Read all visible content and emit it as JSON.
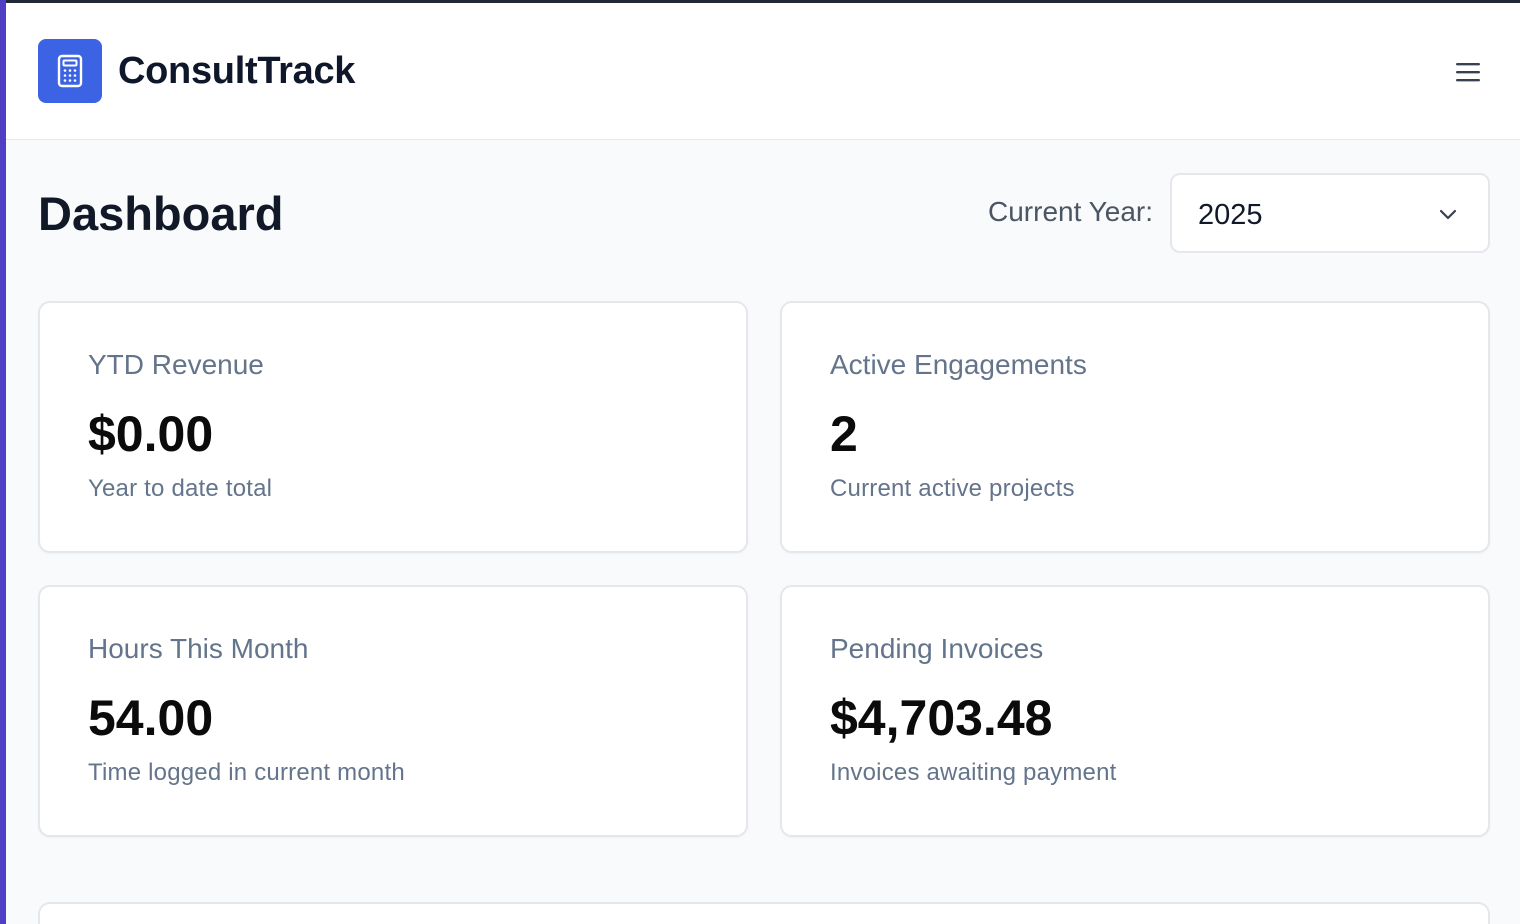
{
  "app": {
    "name": "ConsultTrack",
    "logo_icon": "calculator-icon",
    "accent": "#3b63e3"
  },
  "header": {
    "menu_icon": "hamburger-menu-icon"
  },
  "dashboard": {
    "title": "Dashboard",
    "year_filter": {
      "label": "Current Year:",
      "selected": "2025"
    }
  },
  "cards": [
    {
      "label": "YTD Revenue",
      "value": "$0.00",
      "sub": "Year to date total"
    },
    {
      "label": "Active Engagements",
      "value": "2",
      "sub": "Current active projects"
    },
    {
      "label": "Hours This Month",
      "value": "54.00",
      "sub": "Time logged in current month"
    },
    {
      "label": "Pending Invoices",
      "value": "$4,703.48",
      "sub": "Invoices awaiting payment"
    }
  ]
}
